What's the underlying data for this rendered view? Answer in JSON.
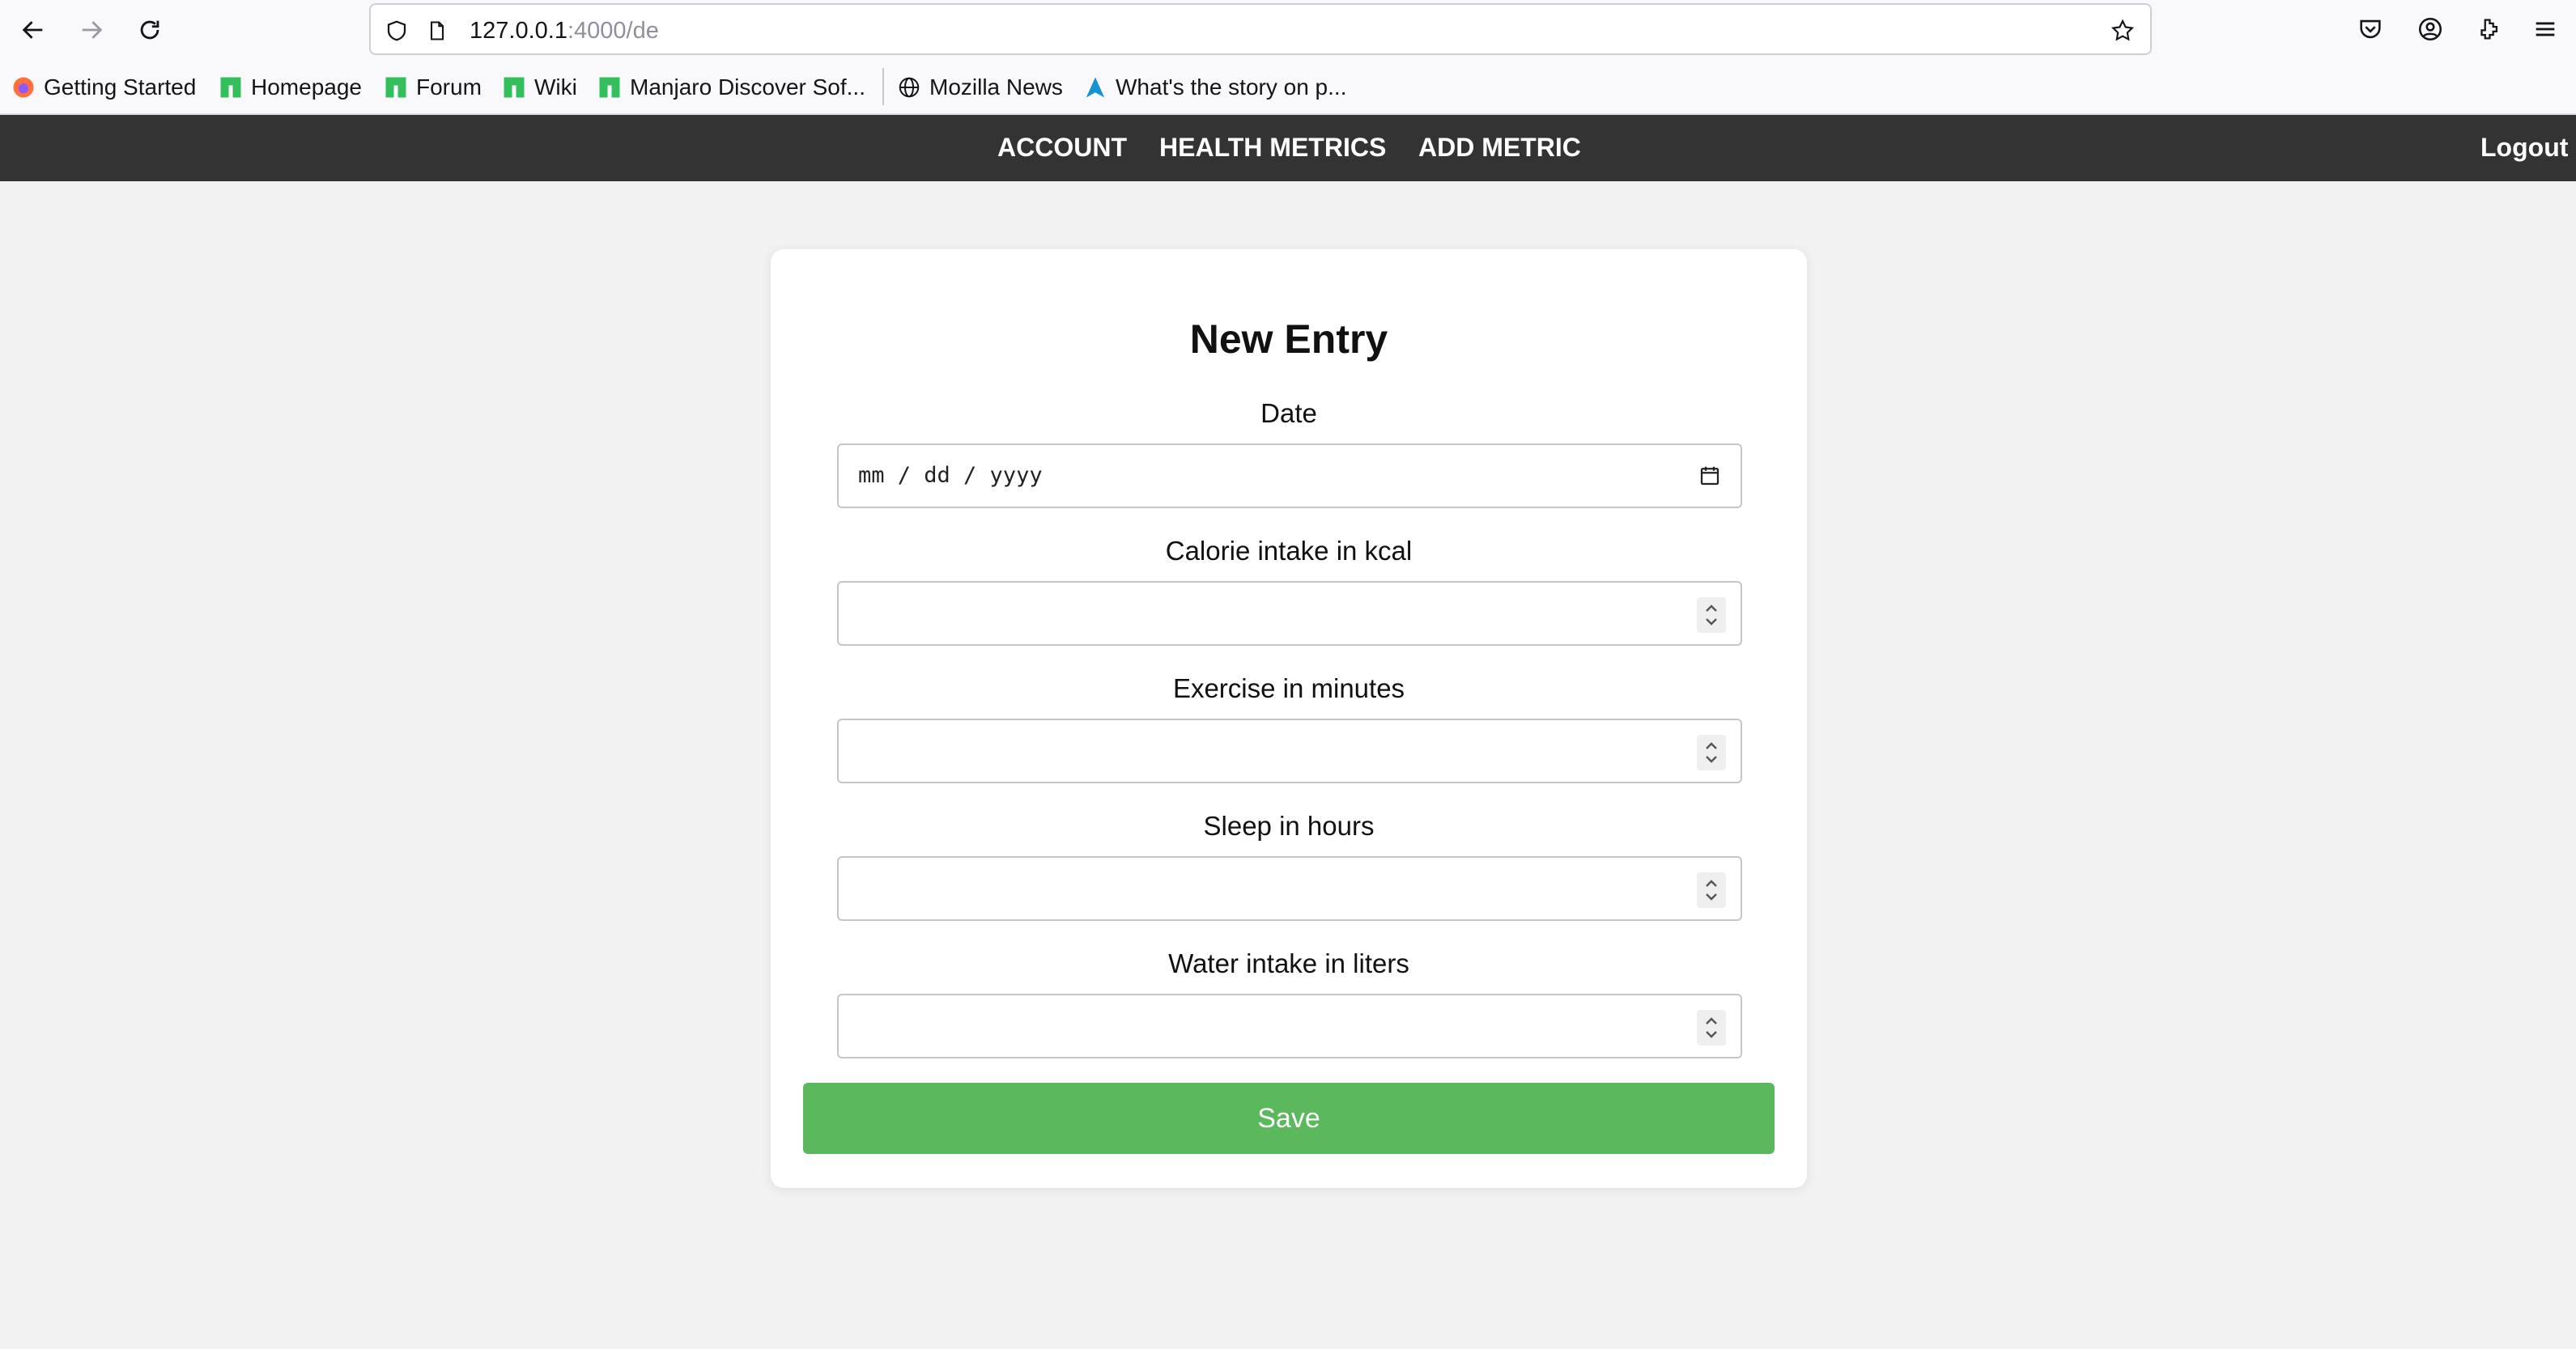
{
  "browser": {
    "url_host": "127.0.0.1",
    "url_path": ":4000/de",
    "bookmarks": [
      {
        "label": "Getting Started",
        "icon": "firefox-icon"
      },
      {
        "label": "Homepage",
        "icon": "manjaro-icon"
      },
      {
        "label": "Forum",
        "icon": "manjaro-icon"
      },
      {
        "label": "Wiki",
        "icon": "manjaro-icon"
      },
      {
        "label": "Manjaro Discover Sof...",
        "icon": "manjaro-icon"
      },
      {
        "label": "Mozilla News",
        "icon": "globe-icon"
      },
      {
        "label": "What's the story on p...",
        "icon": "arch-icon"
      }
    ]
  },
  "site_nav": {
    "items": [
      "ACCOUNT",
      "HEALTH METRICS",
      "ADD METRIC"
    ],
    "logout": "Logout",
    "background": "#333333"
  },
  "form": {
    "title": "New Entry",
    "fields": [
      {
        "label": "Date",
        "type": "date",
        "value": "mm / dd / yyyy"
      },
      {
        "label": "Calorie intake in kcal",
        "type": "number",
        "value": ""
      },
      {
        "label": "Exercise in minutes",
        "type": "number",
        "value": ""
      },
      {
        "label": "Sleep in hours",
        "type": "number",
        "value": ""
      },
      {
        "label": "Water intake in liters",
        "type": "number",
        "value": ""
      }
    ],
    "save_label": "Save",
    "save_color": "#5cb85c"
  }
}
